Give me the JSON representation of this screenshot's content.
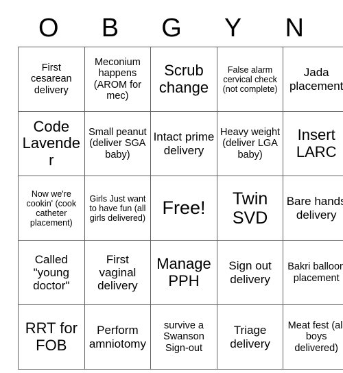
{
  "card": {
    "header_letters": [
      "O",
      "B",
      "G",
      "Y",
      "N"
    ],
    "rows": [
      [
        "First cesarean delivery",
        "Meconium happens (AROM for mec)",
        "Scrub change",
        "False alarm cervical check (not complete)",
        "Jada placement"
      ],
      [
        "Code Lavender",
        "Small peanut (deliver SGA baby)",
        "Intact prime delivery",
        "Heavy weight (deliver LGA baby)",
        "Insert LARC"
      ],
      [
        "Now we're cookin' (cook catheter placement)",
        "Girls Just want to have fun (all girls delivered)",
        "Free!",
        "Twin SVD",
        "Bare hands delivery"
      ],
      [
        "Called \"young doctor\"",
        "First vaginal delivery",
        "Manage PPH",
        "Sign out delivery",
        "Bakri balloon placement"
      ],
      [
        "RRT for FOB",
        "Perform amniotomy",
        "survive a Swanson Sign-out",
        "Triage delivery",
        "Meat fest (all boys delivered)"
      ]
    ],
    "free_space": {
      "row": 2,
      "col": 2,
      "label": "Free!"
    },
    "colors": {
      "background": "#ffffff",
      "text": "#000000",
      "grid_line": "#5f5f5f"
    }
  }
}
